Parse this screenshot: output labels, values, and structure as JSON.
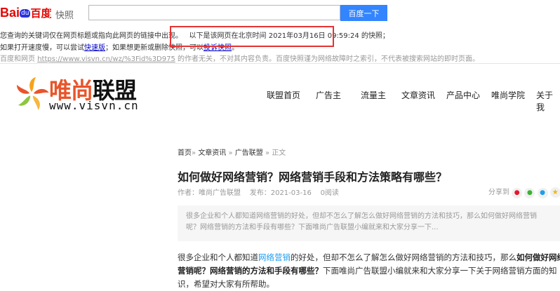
{
  "baidu": {
    "logo_text": "Bai",
    "logo_du": "du",
    "logo_cn": "百度",
    "snapshot_label": "快照",
    "search_value": "",
    "search_button": "百度一下",
    "line1_a": "您查询的关键词仅在网页标题或指向此网页的链接中出现。",
    "line1_b": "以下是该网页在北京时间 2021年03月16日 09:59:24 的快照；",
    "line2_a": "如果打开速度慢，可以尝试",
    "line2_link": "快速版",
    "line2_b": "；如果想更新或删除快照，可以",
    "line2_link2": "投诉快照",
    "line2_c": "。",
    "line3_a": "百度和网页",
    "line3_url": "https://www.visvn.cn/wz/%3Fid%3D975",
    "line3_b": "的作者无关，不对其内容负责。百度快照谨为网络故障时之索引，不代表被搜索网站的即时页面。",
    "highlight_color": "#e53333"
  },
  "site": {
    "logo_cn_a": "唯尚",
    "logo_cn_b": "联盟",
    "logo_url": "www.visvn.cn",
    "nav": [
      "联盟首页",
      "广告主",
      "流量主",
      "文章资讯",
      "产品中心",
      "唯尚学院",
      "关于我"
    ]
  },
  "article": {
    "breadcrumb": [
      "首页",
      "文章资讯",
      "广告联盟",
      "正文"
    ],
    "sep": "»",
    "title": "如何做好网络营销？网络营销手段和方法策略有哪些？",
    "author": "作者：唯尚广告联盟",
    "date": "发布：2021-03-16",
    "reads": "0阅读",
    "share": "分享到",
    "summary": "很多企业和个人都知道网络营销的好处，但却不怎么了解怎么做好网络营销的方法和技巧，那么如何做好网络营销呢？网络营销的方法和手段有哪些？下面唯尚广告联盟小编就来和大家分享一下...",
    "p_a": "很多企业和个人都知道",
    "p_link": "网络营销",
    "p_b": "的好处，但却不怎么了解怎么做好网络营销的方法和技巧，那么",
    "p_bold": "如何做好网络营销呢？网络营销的方法和手段有哪些？",
    "p_c": "下面唯尚广告联盟小编就来和大家分享一下关于网络营销方面的知识，希望对大家有所帮助。"
  }
}
